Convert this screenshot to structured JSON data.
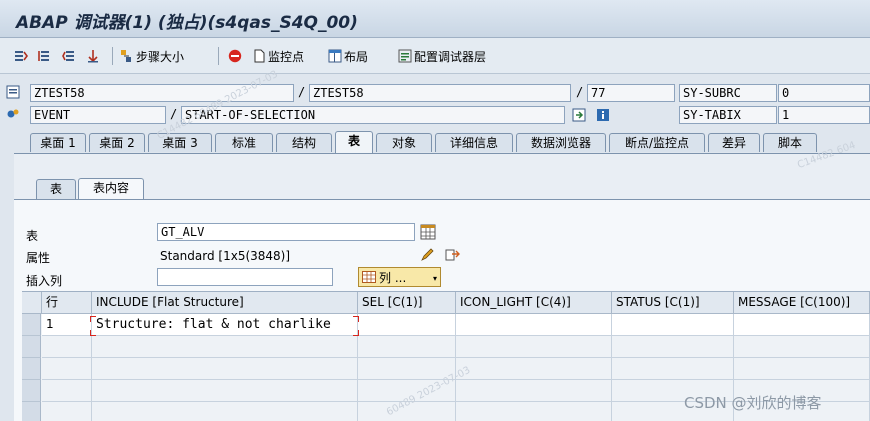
{
  "window": {
    "title": "ABAP 调试器(1) (独占)(s4qas_S4Q_00)"
  },
  "toolbar": {
    "items": [
      {
        "icon": "step-into-icon",
        "label": ""
      },
      {
        "icon": "step-over-icon",
        "label": ""
      },
      {
        "icon": "return-icon",
        "label": ""
      },
      {
        "icon": "continue-icon",
        "label": ""
      },
      {
        "icon": "step-size-icon",
        "label": "步骤大小"
      },
      {
        "icon": "stop-icon",
        "label": ""
      },
      {
        "icon": "watchpoint-icon",
        "label": "监控点"
      },
      {
        "icon": "layout-icon",
        "label": "布局"
      },
      {
        "icon": "config-icon",
        "label": "配置调试器层"
      }
    ]
  },
  "context": {
    "program": "ZTEST58",
    "include": "ZTEST58",
    "line": "77",
    "event_type": "EVENT",
    "event_name": "START-OF-SELECTION",
    "sy_fields": [
      {
        "name": "SY-SUBRC",
        "value": "0"
      },
      {
        "name": "SY-TABIX",
        "value": "1"
      }
    ]
  },
  "tabs": [
    {
      "label": "桌面 1",
      "active": false
    },
    {
      "label": "桌面 2",
      "active": false
    },
    {
      "label": "桌面 3",
      "active": false
    },
    {
      "label": "标准",
      "active": false
    },
    {
      "label": "结构",
      "active": false
    },
    {
      "label": "表",
      "active": true
    },
    {
      "label": "对象",
      "active": false
    },
    {
      "label": "详细信息",
      "active": false
    },
    {
      "label": "数据浏览器",
      "active": false
    },
    {
      "label": "断点/监控点",
      "active": false
    },
    {
      "label": "差异",
      "active": false
    },
    {
      "label": "脚本",
      "active": false
    }
  ],
  "subtabs": [
    {
      "label": "表",
      "active": false
    },
    {
      "label": "表内容",
      "active": true
    }
  ],
  "form": {
    "table_label": "表",
    "table_value": "GT_ALV",
    "attr_label": "属性",
    "attr_value": "Standard [1x5(3848)]",
    "insert_col_label": "插入列",
    "insert_col_value": "",
    "columns_button": "列 ..."
  },
  "grid": {
    "headers": [
      "行",
      "INCLUDE [Flat Structure]",
      "SEL [C(1)]",
      "ICON_LIGHT [C(4)]",
      "STATUS [C(1)]",
      "MESSAGE [C(100)]"
    ],
    "rows": [
      {
        "row": "1",
        "include": "Structure: flat & not charlike",
        "sel": "",
        "icon_light": "",
        "status": "",
        "message": ""
      }
    ]
  },
  "watermarks": [
    "C14482 60489 2023-07-03",
    "C14482 604",
    "60489 2023-07-03"
  ],
  "csdn": "CSDN @刘欣的博客",
  "colors": {
    "accent_red": "#d7261e",
    "tab_border": "#7d93ad",
    "title_text": "#1a2b44"
  }
}
